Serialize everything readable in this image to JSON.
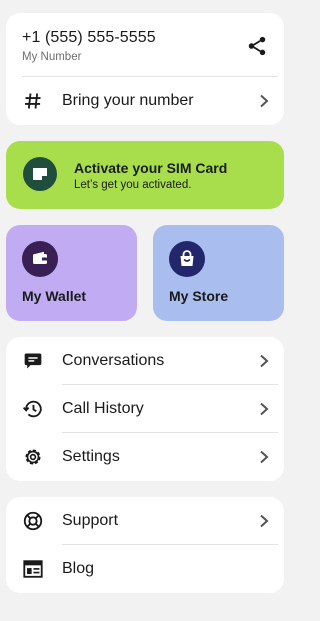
{
  "number_card": {
    "phone": "+1 (555) 555-5555",
    "phone_caption": "My Number",
    "bring_number_label": "Bring your number"
  },
  "sim_banner": {
    "title": "Activate your SIM Card",
    "subtitle": "Let’s get you activated."
  },
  "tiles": {
    "wallet_label": "My Wallet",
    "store_label": "My Store"
  },
  "menu": {
    "items": [
      {
        "label": "Conversations",
        "icon": "chat-bubble-icon"
      },
      {
        "label": "Call History",
        "icon": "history-icon"
      },
      {
        "label": "Settings",
        "icon": "gear-icon"
      }
    ]
  },
  "help": {
    "items": [
      {
        "label": "Support",
        "icon": "lifebuoy-icon"
      },
      {
        "label": "Blog",
        "icon": "article-icon"
      }
    ]
  },
  "colors": {
    "background": "#f2f2f2",
    "sim_banner": "#a8de4b",
    "sim_icon": "#1f4f3c",
    "wallet_tile": "#c1acf4",
    "wallet_icon": "#3a1f55",
    "store_tile": "#a9bdee",
    "store_icon": "#22266b"
  }
}
